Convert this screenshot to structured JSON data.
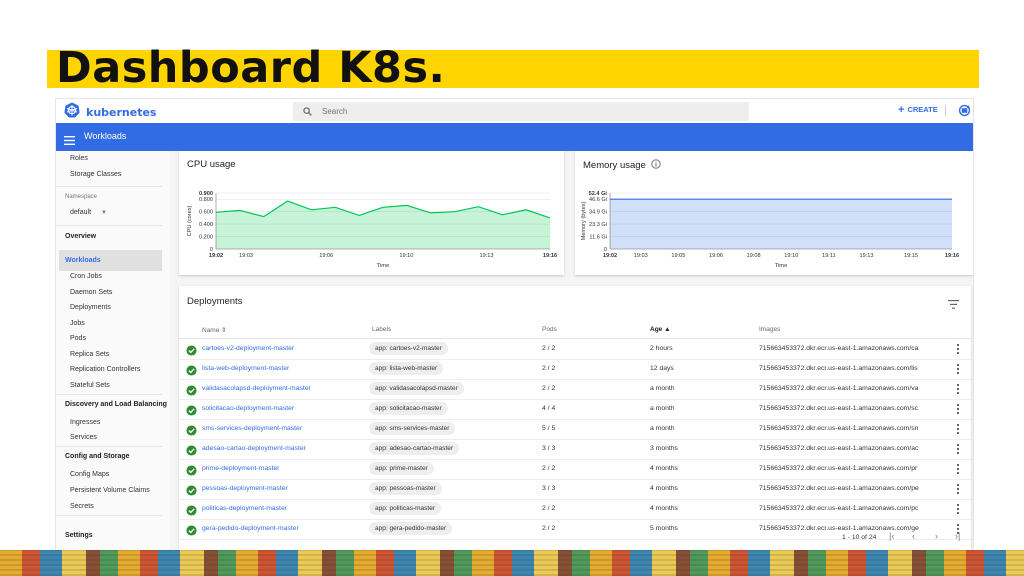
{
  "slide": {
    "title": "Dashboard K8s."
  },
  "header": {
    "brand": "kubernetes",
    "search_placeholder": "Search",
    "create_label": "CREATE"
  },
  "toolbar": {
    "section_title": "Workloads"
  },
  "sidebar": {
    "items_top": [
      "Roles",
      "Storage Classes"
    ],
    "namespace_label": "Namespace",
    "namespace_value": "default",
    "overview": "Overview",
    "workloads": "Workloads",
    "workload_items": [
      "Cron Jobs",
      "Daemon Sets",
      "Deployments",
      "Jobs",
      "Pods",
      "Replica Sets",
      "Replication Controllers",
      "Stateful Sets"
    ],
    "discovery": "Discovery and Load Balancing",
    "discovery_items": [
      "Ingresses",
      "Services"
    ],
    "config": "Config and Storage",
    "config_items": [
      "Config Maps",
      "Persistent Volume Claims",
      "Secrets"
    ],
    "settings": "Settings"
  },
  "cpu_card": {
    "title": "CPU usage"
  },
  "memory_card": {
    "title": "Memory usage"
  },
  "chart_data": [
    {
      "type": "area",
      "ylabel": "CPU (cores)",
      "xlabel": "Time",
      "ylim": [
        0,
        0.9
      ],
      "yticks": [
        "0.900",
        "0.800",
        "0.600",
        "0.400",
        "0.200",
        "0"
      ],
      "ytick_values": [
        0.9,
        0.8,
        0.6,
        0.4,
        0.2,
        0
      ],
      "xticks": [
        "19:02",
        "19:03",
        "19:06",
        "19:10",
        "19:13",
        "19:16"
      ],
      "xtick_positions": [
        0,
        0.09,
        0.33,
        0.57,
        0.81,
        1.0
      ],
      "xtick_bold": [
        true,
        false,
        false,
        false,
        false,
        true
      ],
      "series": [
        {
          "values": [
            0.59,
            0.62,
            0.52,
            0.77,
            0.63,
            0.67,
            0.54,
            0.67,
            0.7,
            0.58,
            0.6,
            0.68,
            0.55,
            0.63,
            0.5
          ]
        }
      ],
      "color": "#00c752"
    },
    {
      "type": "area",
      "ylabel": "Memory (bytes)",
      "xlabel": "Time",
      "ylim": [
        0,
        52.4
      ],
      "yticks": [
        "52.4 Gi",
        "46.6 Gi",
        "34.9 Gi",
        "23.3 Gi",
        "11.6 Gi",
        "0"
      ],
      "ytick_values": [
        52.4,
        46.6,
        34.9,
        23.3,
        11.6,
        0
      ],
      "xticks": [
        "19:02",
        "19:03",
        "19:05",
        "19:06",
        "19:08",
        "19:10",
        "19:11",
        "19:13",
        "19:15",
        "19:16"
      ],
      "xtick_positions": [
        0,
        0.09,
        0.2,
        0.31,
        0.42,
        0.53,
        0.64,
        0.75,
        0.88,
        1.0
      ],
      "xtick_bold": [
        true,
        false,
        false,
        false,
        false,
        false,
        false,
        false,
        false,
        true
      ],
      "series": [
        {
          "values": [
            46.6,
            46.6,
            46.6,
            46.6,
            46.6,
            46.6,
            46.6,
            46.6,
            46.6,
            46.6,
            46.6,
            46.6,
            46.6,
            46.6,
            46.6
          ]
        }
      ],
      "color": "#326ce5"
    }
  ],
  "deployments": {
    "title": "Deployments",
    "columns": {
      "name": "Name",
      "labels": "Labels",
      "pods": "Pods",
      "age": "Age",
      "images": "Images"
    },
    "rows": [
      {
        "name": "cartoes-v2-deployment-master",
        "label": "app: cartoes-v2-master",
        "pods": "2 / 2",
        "age": "2 hours",
        "image": "715663453372.dkr.ecr.us-east-1.amazonaws.com/ca"
      },
      {
        "name": "lista-web-deployment-master",
        "label": "app: lista-web-master",
        "pods": "2 / 2",
        "age": "12 days",
        "image": "715663453372.dkr.ecr.us-east-1.amazonaws.com/lis"
      },
      {
        "name": "validasacolapsd-deployment-master",
        "label": "app: validasacolapsd-master",
        "pods": "2 / 2",
        "age": "a month",
        "image": "715663453372.dkr.ecr.us-east-1.amazonaws.com/va"
      },
      {
        "name": "solicitacao-deployment-master",
        "label": "app: solicitacao-master",
        "pods": "4 / 4",
        "age": "a month",
        "image": "715663453372.dkr.ecr.us-east-1.amazonaws.com/sc"
      },
      {
        "name": "sms-services-deployment-master",
        "label": "app: sms-services-master",
        "pods": "5 / 5",
        "age": "a month",
        "image": "715663453372.dkr.ecr.us-east-1.amazonaws.com/sn"
      },
      {
        "name": "adesao-cartao-deployment-master",
        "label": "app: adesao-cartao-master",
        "pods": "3 / 3",
        "age": "3 months",
        "image": "715663453372.dkr.ecr.us-east-1.amazonaws.com/ac"
      },
      {
        "name": "prime-deployment-master",
        "label": "app: prime-master",
        "pods": "2 / 2",
        "age": "4 months",
        "image": "715663453372.dkr.ecr.us-east-1.amazonaws.com/pr"
      },
      {
        "name": "pessoas-deployment-master",
        "label": "app: pessoas-master",
        "pods": "3 / 3",
        "age": "4 months",
        "image": "715663453372.dkr.ecr.us-east-1.amazonaws.com/pe"
      },
      {
        "name": "politicas-deployment-master",
        "label": "app: politicas-master",
        "pods": "2 / 2",
        "age": "4 months",
        "image": "715663453372.dkr.ecr.us-east-1.amazonaws.com/pc"
      },
      {
        "name": "gera-pedido-deployment-master",
        "label": "app: gera-pedido-master",
        "pods": "2 / 2",
        "age": "5 months",
        "image": "715663453372.dkr.ecr.us-east-1.amazonaws.com/ge"
      }
    ],
    "pagination": "1 - 10 of 24"
  },
  "colors": {
    "accent": "#326ce5",
    "title_highlight": "#ffd400",
    "success": "#2e8b2e"
  }
}
